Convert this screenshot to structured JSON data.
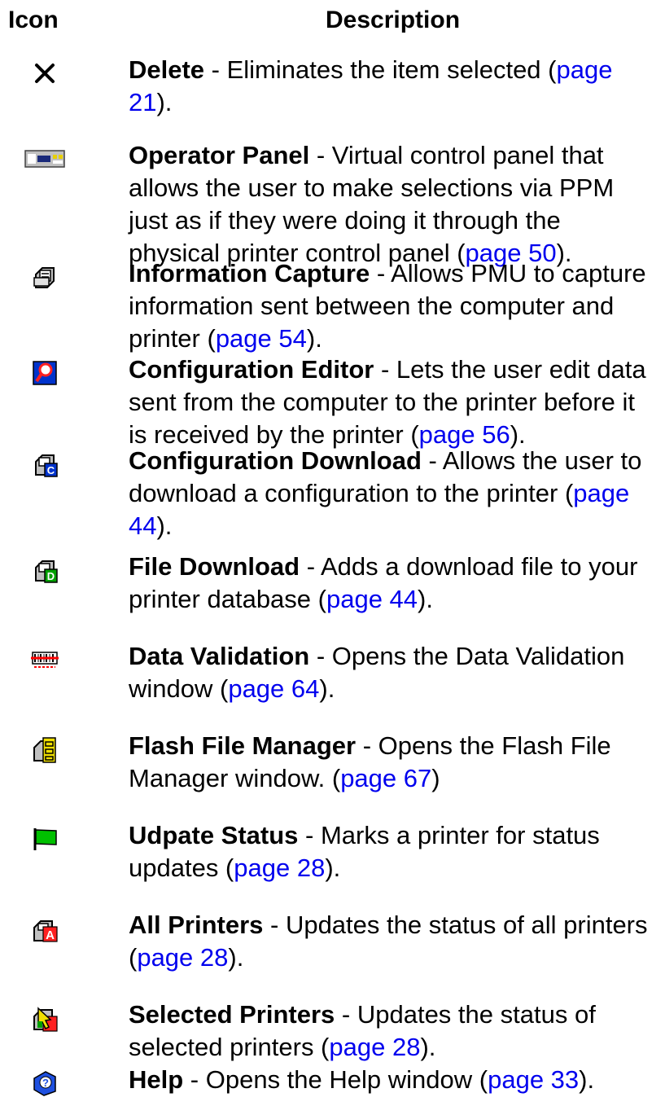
{
  "header": {
    "icon": "Icon",
    "description": "Description"
  },
  "rows": [
    {
      "icon": "delete-x-icon",
      "title": "Delete",
      "pre": " - Eliminates the item selected (",
      "link": "page 21",
      "post": ")."
    },
    {
      "icon": "operator-panel-icon",
      "title": "Operator Panel",
      "pre": " - Virtual control panel that allows the user to make selections via PPM just as if they were doing it through the physical printer control panel (",
      "link": "page 50",
      "post": ")."
    },
    {
      "icon": "information-capture-icon",
      "title": "Information Capture",
      "pre": " - Allows PMU to capture information sent between the computer and printer (",
      "link": "page 54",
      "post": ")."
    },
    {
      "icon": "configuration-editor-icon",
      "title": "Configuration Editor",
      "pre": " - Lets the user edit data sent from the computer to the printer before it is received by the printer (",
      "link": "page 56",
      "post": ")."
    },
    {
      "icon": "configuration-download-icon",
      "title": "Configuration Download",
      "pre": " - Allows the user to download a configuration to the printer (",
      "link": "page 44",
      "post": ")."
    },
    {
      "icon": "file-download-icon",
      "title": "File Download",
      "pre": " - Adds a download file to your printer database (",
      "link": "page 44",
      "post": ")."
    },
    {
      "icon": "data-validation-icon",
      "title": "Data Validation",
      "pre": " - Opens the Data Validation window (",
      "link": "page 64",
      "post": ")."
    },
    {
      "icon": "flash-file-manager-icon",
      "title": "Flash File Manager",
      "pre": " - Opens the Flash File Manager window. (",
      "link": "page 67",
      "post": ")"
    },
    {
      "icon": "green-flag-icon",
      "title": "Udpate Status",
      "pre": " - Marks a printer for status updates (",
      "link": "page 28",
      "post": ")."
    },
    {
      "icon": "all-printers-icon",
      "title": "All Printers",
      "pre": " - Updates the status of all printers (",
      "link": "page 28",
      "post": ")."
    },
    {
      "icon": "selected-printers-icon",
      "title": "Selected Printers",
      "pre": " - Updates the status of selected printers (",
      "link": "page 28",
      "post": ")."
    },
    {
      "icon": "help-icon",
      "title": "Help",
      "pre": " - Opens the Help window (",
      "link": "page 33",
      "post": ")."
    }
  ]
}
